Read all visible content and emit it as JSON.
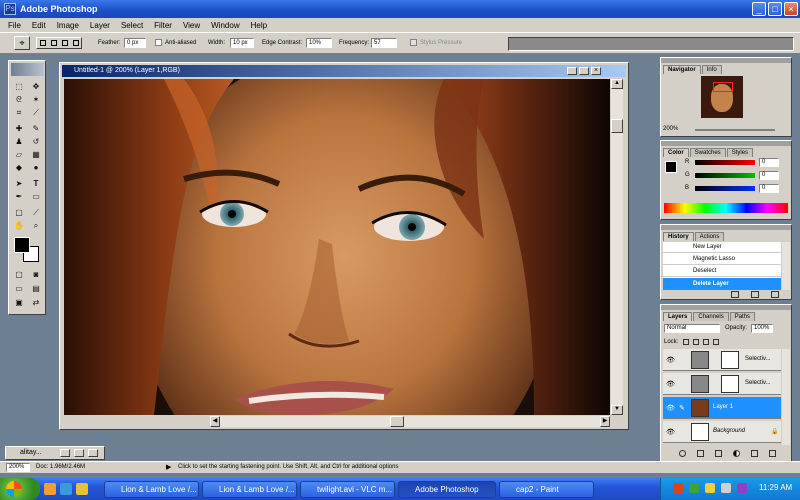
{
  "window": {
    "title": "Adobe Photoshop",
    "icon": "photoshop-icon"
  },
  "menu": [
    "File",
    "Edit",
    "Image",
    "Layer",
    "Select",
    "Filter",
    "View",
    "Window",
    "Help"
  ],
  "options": {
    "feather_label": "Feather:",
    "feather_value": "0 px",
    "antialiased_label": "Anti-aliased",
    "width_label": "Width:",
    "width_value": "10 px",
    "edge_contrast_label": "Edge Contrast:",
    "edge_contrast_value": "10%",
    "frequency_label": "Frequency:",
    "frequency_value": "57",
    "stylus_label": "Stylus Pressure"
  },
  "document": {
    "title": "Untitled-1 @ 200% (Layer 1,RGB)"
  },
  "navigator": {
    "tabs": [
      "Navigator",
      "Info"
    ],
    "zoom": "200%"
  },
  "color_palette": {
    "tabs": [
      "Color",
      "Swatches",
      "Styles"
    ],
    "channels": [
      {
        "label": "R",
        "value": "0"
      },
      {
        "label": "G",
        "value": "0"
      },
      {
        "label": "B",
        "value": "0"
      }
    ]
  },
  "history": {
    "tabs": [
      "History",
      "Actions"
    ],
    "items": [
      "New Layer",
      "Magnetic Lasso",
      "Deselect",
      "Delete Layer"
    ]
  },
  "layers": {
    "tabs": [
      "Layers",
      "Channels",
      "Paths"
    ],
    "blend_mode": "Normal",
    "opacity_label": "Opacity:",
    "opacity_value": "100%",
    "lock_label": "Lock:",
    "rows": [
      {
        "name": "Selectiv...",
        "selected": false
      },
      {
        "name": "Selectiv...",
        "selected": false
      },
      {
        "name": "Layer 1",
        "selected": true
      },
      {
        "name": "Background",
        "selected": false
      }
    ]
  },
  "minimized_doc": {
    "label": "alitay..."
  },
  "status": {
    "zoom": "200%",
    "doc": "Doc: 1.96M/2.46M",
    "hint": "Click to set the starting fastening point.  Use Shift, Alt, and Ctrl for additional options"
  },
  "taskbar": {
    "items": [
      "Lion & Lamb Love /...",
      "Lion & Lamb Love /...",
      "twilight.avi - VLC m...",
      "Adobe Photoshop",
      "cap2 - Paint"
    ],
    "active_index": 3,
    "clock": "11:29 AM"
  },
  "colors": {
    "titlebar": "#1b4fc8",
    "chrome": "#d4d0c8",
    "selection": "#1e90ff"
  }
}
